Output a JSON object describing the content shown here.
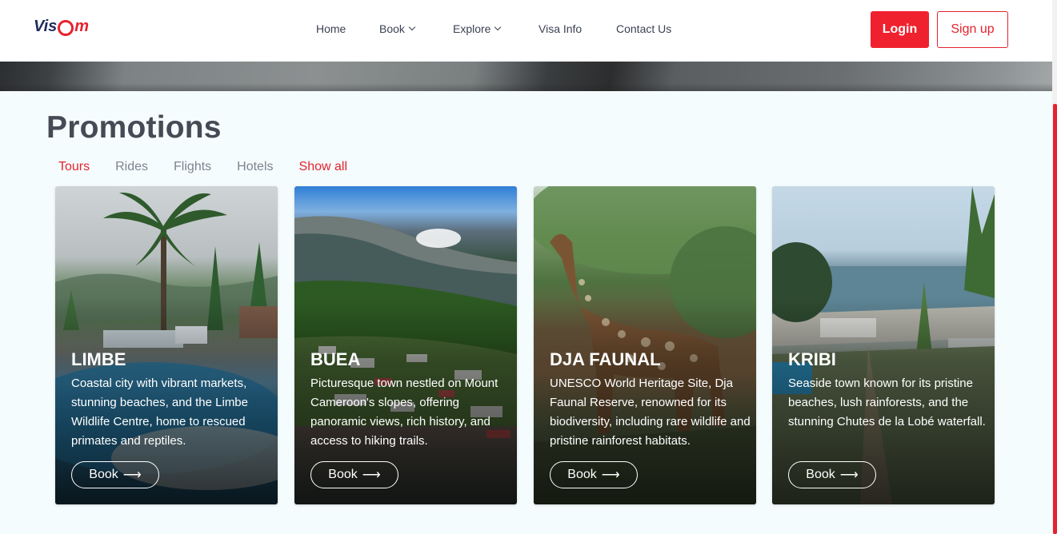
{
  "brand": {
    "prefix": "Vis",
    "suffix": "m"
  },
  "nav": [
    {
      "label": "Home",
      "has_dropdown": false
    },
    {
      "label": "Book",
      "has_dropdown": true
    },
    {
      "label": "Explore",
      "has_dropdown": true
    },
    {
      "label": "Visa Info",
      "has_dropdown": false
    },
    {
      "label": "Contact Us",
      "has_dropdown": false
    }
  ],
  "auth": {
    "login": "Login",
    "signup": "Sign up"
  },
  "promotions": {
    "title": "Promotions",
    "tabs": [
      "Tours",
      "Rides",
      "Flights",
      "Hotels"
    ],
    "active_tab": "Tours",
    "show_all": "Show all",
    "cards": [
      {
        "title": "LIMBE",
        "desc": "Coastal city with vibrant markets, stunning beaches, and the Limbe Wildlife Centre, home to rescued primates and reptiles.",
        "button": "Book"
      },
      {
        "title": "BUEA",
        "desc": "Picturesque town nestled on Mount Cameroon's slopes, offering panoramic views, rich history, and access to hiking trails.",
        "button": "Book"
      },
      {
        "title": "DJA FAUNAL",
        "desc": "UNESCO World Heritage Site, Dja Faunal Reserve, renowned for its biodiversity, including rare wildlife and pristine rainforest habitats.",
        "button": "Book"
      },
      {
        "title": "KRIBI",
        "desc": "Seaside town known for its pristine beaches, lush rainforests, and the stunning Chutes de la Lobé waterfall.",
        "button": "Book"
      }
    ]
  },
  "colors": {
    "accent": "#e5232e",
    "brand_dark": "#1d2b5c",
    "heading": "#454a55"
  }
}
